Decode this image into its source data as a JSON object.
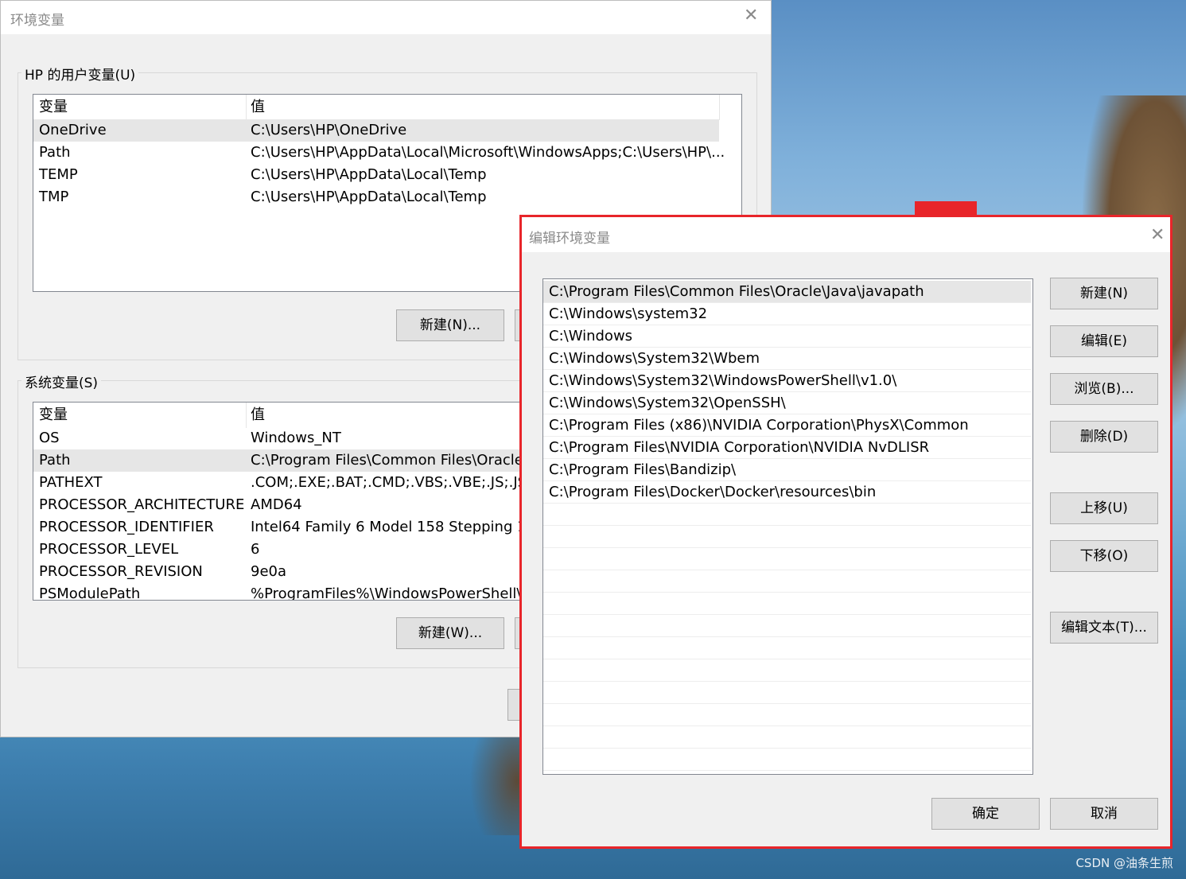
{
  "main_window": {
    "title": "环境变量",
    "user_group": {
      "legend": "HP 的用户变量(U)",
      "columns": [
        "变量",
        "值"
      ],
      "rows": [
        {
          "name": "OneDrive",
          "value": "C:\\Users\\HP\\OneDrive"
        },
        {
          "name": "Path",
          "value": "C:\\Users\\HP\\AppData\\Local\\Microsoft\\WindowsApps;C:\\Users\\HP\\..."
        },
        {
          "name": "TEMP",
          "value": "C:\\Users\\HP\\AppData\\Local\\Temp"
        },
        {
          "name": "TMP",
          "value": "C:\\Users\\HP\\AppData\\Local\\Temp"
        }
      ],
      "new_button": "新建(N)..."
    },
    "system_group": {
      "legend": "系统变量(S)",
      "columns": [
        "变量",
        "值"
      ],
      "rows": [
        {
          "name": "OS",
          "value": "Windows_NT"
        },
        {
          "name": "Path",
          "value": "C:\\Program Files\\Common Files\\Oracle\\"
        },
        {
          "name": "PATHEXT",
          "value": ".COM;.EXE;.BAT;.CMD;.VBS;.VBE;.JS;.JSE;.\\"
        },
        {
          "name": "PROCESSOR_ARCHITECTURE",
          "value": "AMD64"
        },
        {
          "name": "PROCESSOR_IDENTIFIER",
          "value": "Intel64 Family 6 Model 158 Stepping 1"
        },
        {
          "name": "PROCESSOR_LEVEL",
          "value": "6"
        },
        {
          "name": "PROCESSOR_REVISION",
          "value": "9e0a"
        },
        {
          "name": "PSModulePath",
          "value": "%ProgramFiles%\\WindowsPowerShell\\M"
        }
      ],
      "new_button": "新建(W)..."
    }
  },
  "edit_dialog": {
    "title": "编辑环境变量",
    "paths": [
      "C:\\Program Files\\Common Files\\Oracle\\Java\\javapath",
      "C:\\Windows\\system32",
      "C:\\Windows",
      "C:\\Windows\\System32\\Wbem",
      "C:\\Windows\\System32\\WindowsPowerShell\\v1.0\\",
      "C:\\Windows\\System32\\OpenSSH\\",
      "C:\\Program Files (x86)\\NVIDIA Corporation\\PhysX\\Common",
      "C:\\Program Files\\NVIDIA Corporation\\NVIDIA NvDLISR",
      "C:\\Program Files\\Bandizip\\",
      "C:\\Program Files\\Docker\\Docker\\resources\\bin"
    ],
    "buttons": {
      "new": "新建(N)",
      "edit": "编辑(E)",
      "browse": "浏览(B)...",
      "delete": "删除(D)",
      "move_up": "上移(U)",
      "move_down": "下移(O)",
      "edit_text": "编辑文本(T)...",
      "ok": "确定",
      "cancel": "取消"
    }
  },
  "watermark": "CSDN @油条生煎",
  "colors": {
    "highlight_border": "#e8252a",
    "selection": "#e6e6e6"
  }
}
